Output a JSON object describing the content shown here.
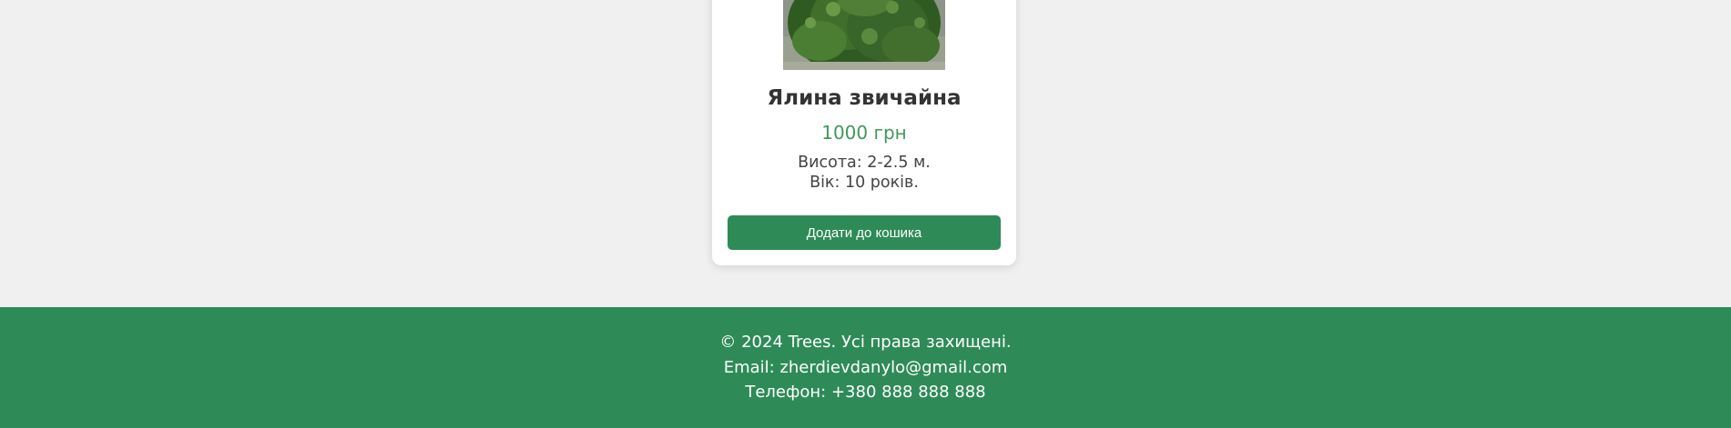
{
  "product": {
    "name": "Ялина звичайна",
    "price": "1000 грн",
    "height": "Висота: 2-2.5 м.",
    "age": "Вік: 10 років.",
    "add_to_cart_label": "Додати до кошика",
    "image_icon": "spruce-tree-photo"
  },
  "footer": {
    "copyright": "© 2024 Trees. Усі права захищені.",
    "email": "Email: zherdievdanylo@gmail.com",
    "phone": "Телефон: +380 888 888 888"
  },
  "colors": {
    "accent": "#2e8b57",
    "price": "#3f9a5a",
    "background": "#f0f0f0",
    "card": "#ffffff"
  }
}
